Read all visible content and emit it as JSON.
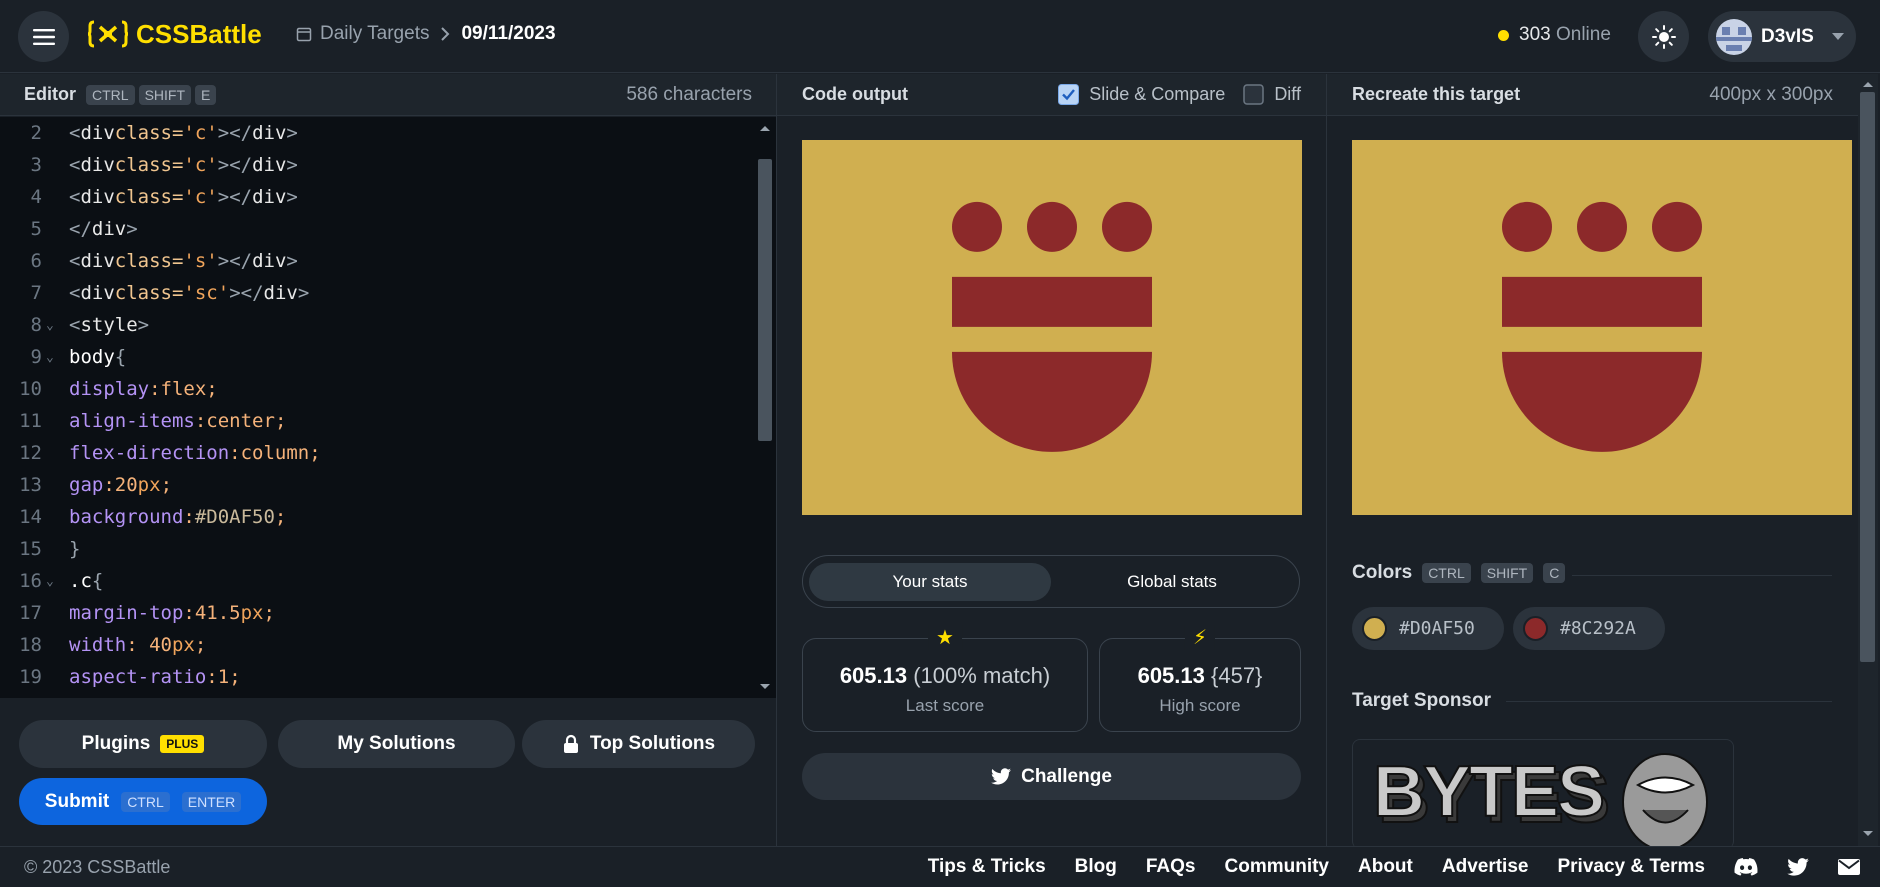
{
  "header": {
    "logo_text": "CSSBattle",
    "breadcrumb_section": "Daily Targets",
    "breadcrumb_current": "09/11/2023",
    "online_count": "303",
    "online_label": "Online",
    "username": "D3vIS"
  },
  "editor": {
    "title": "Editor",
    "shortcut": [
      "CTRL",
      "SHIFT",
      "E"
    ],
    "char_count": "586 characters",
    "lines": [
      {
        "n": "2",
        "fold": false
      },
      {
        "n": "3",
        "fold": false
      },
      {
        "n": "4",
        "fold": false
      },
      {
        "n": "5",
        "fold": false
      },
      {
        "n": "6",
        "fold": false
      },
      {
        "n": "7",
        "fold": false
      },
      {
        "n": "8",
        "fold": true
      },
      {
        "n": "9",
        "fold": true
      },
      {
        "n": "10",
        "fold": false
      },
      {
        "n": "11",
        "fold": false
      },
      {
        "n": "12",
        "fold": false
      },
      {
        "n": "13",
        "fold": false
      },
      {
        "n": "14",
        "fold": false
      },
      {
        "n": "15",
        "fold": false
      },
      {
        "n": "16",
        "fold": true
      },
      {
        "n": "17",
        "fold": false
      },
      {
        "n": "18",
        "fold": false
      },
      {
        "n": "19",
        "fold": false
      }
    ],
    "code": {
      "div": "div",
      "class_attr": "class=",
      "c_value": "'c'",
      "s_value": "'s'",
      "sc_value": "'sc'",
      "style": "style",
      "body": "body",
      "display_prop": "display",
      "display_val": "flex",
      "align_prop": "align-items",
      "align_val": "center",
      "flexdir_prop": "flex-direction",
      "flexdir_val": "column",
      "gap_prop": "gap",
      "gap_num": "20",
      "px": "px",
      "bg_prop": "background",
      "bg_val": "#D0AF50",
      "c_selector": ".c",
      "margin_prop": "margin-top",
      "margin_num": "41.5",
      "width_prop": "width",
      "width_num": "40",
      "aspect_prop": "aspect-ratio",
      "aspect_num": "1"
    }
  },
  "buttons": {
    "plugins": "Plugins",
    "plus_badge": "PLUS",
    "my_solutions": "My Solutions",
    "top_solutions": "Top Solutions",
    "submit": "Submit",
    "submit_keys": [
      "CTRL",
      "ENTER"
    ]
  },
  "output": {
    "title": "Code output",
    "slide_compare": "Slide & Compare",
    "slide_checked": true,
    "diff": "Diff",
    "diff_checked": false,
    "tab_your": "Your stats",
    "tab_global": "Global stats",
    "last_score": "605.13",
    "last_match": "(100% match)",
    "last_label": "Last score",
    "high_score": "605.13",
    "high_chars": "{457}",
    "high_label": "High score",
    "challenge": "Challenge"
  },
  "target": {
    "title": "Recreate this target",
    "size": "400px x 300px",
    "colors_title": "Colors",
    "colors_keys": [
      "CTRL",
      "SHIFT",
      "C"
    ],
    "colors": [
      "#D0AF50",
      "#8C292A"
    ],
    "sponsor_title": "Target Sponsor",
    "sponsor_text": "BYTES"
  },
  "footer": {
    "copyright": "© 2023 CSSBattle",
    "links": [
      "Tips & Tricks",
      "Blog",
      "FAQs",
      "Community",
      "About",
      "Advertise",
      "Privacy & Terms"
    ]
  },
  "theme": {
    "accent": "#ffdf00",
    "submit_blue": "#0d65de",
    "bg": "#1a2027",
    "target_bg": "#D0AF50",
    "target_fg": "#8C292A"
  }
}
